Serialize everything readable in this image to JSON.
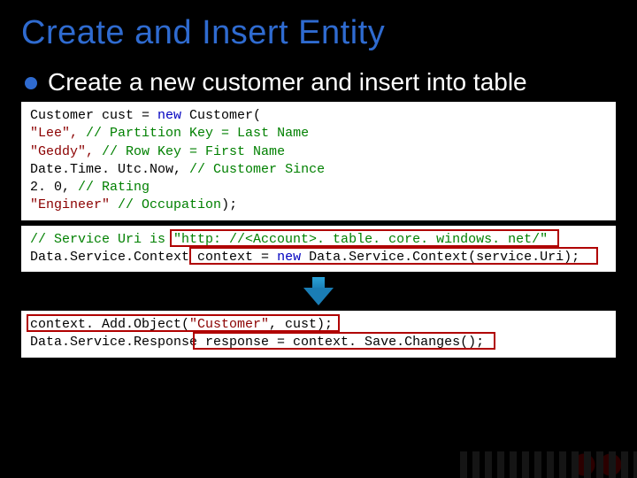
{
  "title": "Create and Insert Entity",
  "bullet": "Create a new customer and insert into table",
  "code1": {
    "l1a": "Customer cust = ",
    "l1b": "new",
    "l1c": " Customer(",
    "l2a": " \"Lee\",",
    "l2b": "              ",
    "l2c": "// Partition Key = Last Name",
    "l3a": " \"Geddy\",",
    "l3b": "           ",
    "l3c": "// Row Key = First Name",
    "l4a": "  Date.Time. Utc.Now,",
    "l4b": "      ",
    "l4c": "// Customer Since",
    "l5a": "  2. 0,",
    "l5b": "              ",
    "l5c": "// Rating",
    "l6a": "  \"Engineer\"",
    "l6b": "              ",
    "l6c": "// Occupation",
    "l6d": ");"
  },
  "code2": {
    "l1a": "// Service Uri is ",
    "l1b": "\"http: //<Account>. table. core. windows. net/\"",
    "l2a": "Data.Service.Context",
    "l2b": " context = ",
    "l2c": "new",
    "l2d": " Data.Service.Context(service.Uri);"
  },
  "code3": {
    "l1a": "context. Add.Object(",
    "l1b": "\"Customer\"",
    "l1c": ", cust);",
    "l2a": "Data.Service.Response",
    "l2b": " response = context. Save.Changes();"
  }
}
